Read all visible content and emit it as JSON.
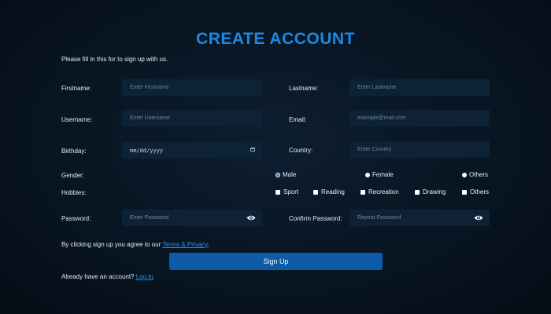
{
  "title": "CREATE ACCOUNT",
  "intro": "Please fill in this for to sign up with us.",
  "fields": {
    "firstname": {
      "label": "Firstname:",
      "placeholder": "Enter Firstname"
    },
    "lastname": {
      "label": "Lastname:",
      "placeholder": "Enter Lastname"
    },
    "username": {
      "label": "Username:",
      "placeholder": "Enter Username"
    },
    "email": {
      "label": "Email:",
      "placeholder": "example@mail.com"
    },
    "birthday": {
      "label": "Birthday:",
      "placeholder": "mm/dd/yyyy"
    },
    "country": {
      "label": "Country:",
      "placeholder": "Enter Country"
    },
    "password": {
      "label": "Password:",
      "placeholder": "Enter Password"
    },
    "confirm_password": {
      "label": "Confirm Password:",
      "placeholder": "Repeat Password"
    }
  },
  "gender": {
    "label": "Gender:",
    "options": [
      "Male",
      "Female",
      "Others"
    ],
    "selected": "Male"
  },
  "hobbies": {
    "label": "Hobbies:",
    "options": [
      "Sport",
      "Reading",
      "Recreation",
      "Drawing",
      "Others"
    ]
  },
  "terms": {
    "prefix": "By clicking sign up you agree to our ",
    "link": "Terms & Privacy",
    "suffix": "."
  },
  "signup_button": "Sign Up",
  "login": {
    "prefix": "Already have an account? ",
    "link": "Log in",
    "suffix": "."
  },
  "colors": {
    "accent": "#1e88e5",
    "button": "#0d5aa7",
    "input_bg": "#0e2236",
    "background": "#081522"
  },
  "icons": {
    "birthday": "calendar-icon",
    "password": "eye-icon",
    "confirm_password": "eye-icon"
  }
}
